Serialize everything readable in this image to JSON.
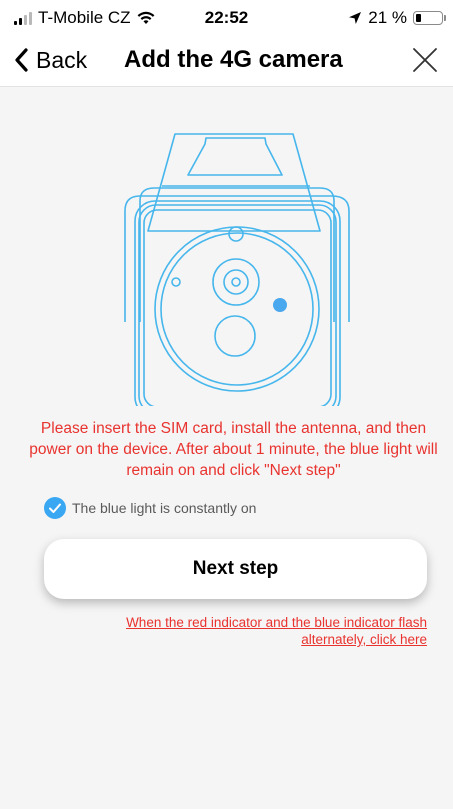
{
  "status_bar": {
    "carrier": "T-Mobile CZ",
    "time": "22:52",
    "battery_percent": "21 %",
    "battery_level": 0.21
  },
  "nav": {
    "back_label": "Back",
    "title": "Add the 4G camera"
  },
  "main": {
    "instructions": "Please insert the SIM card, install the antenna, and then power on the device. After about 1 minute, the blue light will remain on and click \"Next step\"",
    "checkbox": {
      "label": "The blue light is constantly on",
      "checked": true
    },
    "next_button": "Next step",
    "help_link": "When the red indicator and the blue indicator flash alternately, click here"
  },
  "colors": {
    "accent_blue": "#3aa7f2",
    "camera_line": "#46b6ec",
    "warning_red": "#e8332f"
  }
}
